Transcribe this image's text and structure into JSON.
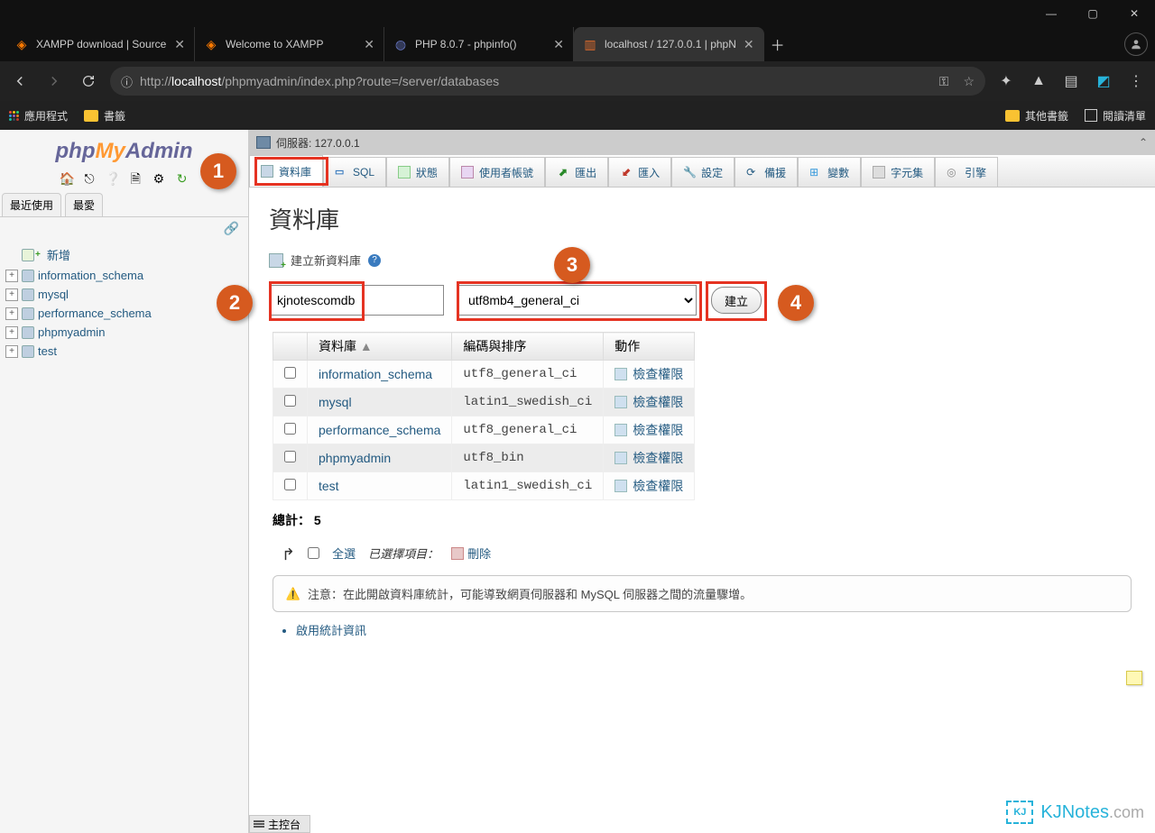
{
  "window": {
    "minimize": "—",
    "maximize": "▢",
    "close": "✕"
  },
  "browser": {
    "tabs": [
      {
        "title": "XAMPP download | Source",
        "favicon": "◆",
        "color": "#ff7a00",
        "active": false
      },
      {
        "title": "Welcome to XAMPP",
        "favicon": "◆",
        "color": "#ff7a00",
        "active": false
      },
      {
        "title": "PHP 8.0.7 - phpinfo()",
        "favicon": "◆",
        "color": "#6676c2",
        "active": false
      },
      {
        "title": "localhost / 127.0.0.1 | phpN",
        "favicon": "▥",
        "color": "#e06c2c",
        "active": true
      }
    ],
    "url_pre": "http://",
    "url_host": "localhost",
    "url_path": "/phpmyadmin/index.php?route=/server/databases",
    "bookmarks": {
      "apps": "應用程式",
      "folder": "書籤",
      "other": "其他書籤",
      "readlist": "閱讀清單"
    }
  },
  "pma": {
    "logo": {
      "a": "php",
      "b": "My",
      "c": "Admin"
    },
    "side_tabs": {
      "recent": "最近使用",
      "fav": "最愛"
    },
    "tree": {
      "new": "新增",
      "dbs": [
        "information_schema",
        "mysql",
        "performance_schema",
        "phpmyadmin",
        "test"
      ]
    },
    "server_label": "伺服器: 127.0.0.1",
    "tabs": {
      "databases": "資料庫",
      "sql": "SQL",
      "status": "狀態",
      "users": "使用者帳號",
      "export": "匯出",
      "import": "匯入",
      "settings": "設定",
      "backup": "備援",
      "variables": "變數",
      "charset": "字元集",
      "engines": "引擎"
    },
    "page": {
      "title": "資料庫",
      "create_label": "建立新資料庫",
      "dbname_value": "kjnotescomdb",
      "collation_value": "utf8mb4_general_ci",
      "create_btn": "建立",
      "cols": {
        "db": "資料庫",
        "coll": "編碼與排序",
        "act": "動作"
      },
      "rows": [
        {
          "name": "information_schema",
          "coll": "utf8_general_ci",
          "act": "檢查權限"
        },
        {
          "name": "mysql",
          "coll": "latin1_swedish_ci",
          "act": "檢查權限"
        },
        {
          "name": "performance_schema",
          "coll": "utf8_general_ci",
          "act": "檢查權限"
        },
        {
          "name": "phpmyadmin",
          "coll": "utf8_bin",
          "act": "檢查權限"
        },
        {
          "name": "test",
          "coll": "latin1_swedish_ci",
          "act": "檢查權限"
        }
      ],
      "total_label": "總計：",
      "total_count": "5",
      "checkall": "全選",
      "withselected": "已選擇項目：",
      "delete": "刪除",
      "notice": "注意：在此開啟資料庫統計，可能導致網頁伺服器和 MySQL 伺服器之間的流量驟增。",
      "stats_link": "啟用統計資訊",
      "console": "主控台"
    }
  },
  "annotations": {
    "1": "1",
    "2": "2",
    "3": "3",
    "4": "4"
  },
  "watermark": {
    "icon": "KJ",
    "name": "KJNotes",
    "dom": ".com"
  }
}
